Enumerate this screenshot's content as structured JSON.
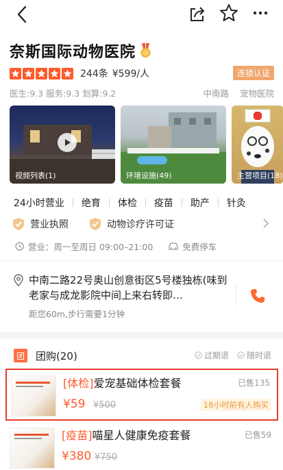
{
  "shop": {
    "name": "奈斯国际动物医院",
    "reviews": "244条",
    "avg_price": "¥599/人",
    "chain_badge": "连锁认证",
    "scores": "医生:9.3 服务:9.3 划算:9.2",
    "area": "中南路",
    "category": "宠物医院",
    "rating_stars": 5
  },
  "photos": [
    {
      "caption": "视频列表(1)"
    },
    {
      "caption": "环境设施(49)"
    },
    {
      "caption": "主营项目(18)"
    }
  ],
  "tags": [
    "24小时营业",
    "绝育",
    "体检",
    "疫苗",
    "助产",
    "针灸"
  ],
  "licenses": [
    "营业执照",
    "动物诊疗许可证"
  ],
  "hours": "营业：周一至周日 09:00–21:00",
  "parking": "免费停车",
  "address": {
    "text": "中南二路22号奥山创意街区5号楼独栋(味到老家与成龙影院中间上来右转即…",
    "distance": "距您60m,步行需要1分钟"
  },
  "groupbuy": {
    "badge": "团",
    "title": "团购(20)",
    "flag1": "过期退",
    "flag2": "随时退",
    "deals": [
      {
        "category": "[体检]",
        "name": "爱宠基础体检套餐",
        "sold": "已售135",
        "price": "¥59",
        "original": "¥500",
        "hot": "18小时前有人购买"
      },
      {
        "category": "[疫苗]",
        "name": "喵星人健康免疫套餐",
        "sold": "已售59",
        "price": "¥380",
        "original": "¥750"
      }
    ]
  },
  "colors": {
    "accent": "#ff5a2c",
    "chain": "#f0a66c",
    "highlight_border": "#e53a2e"
  }
}
